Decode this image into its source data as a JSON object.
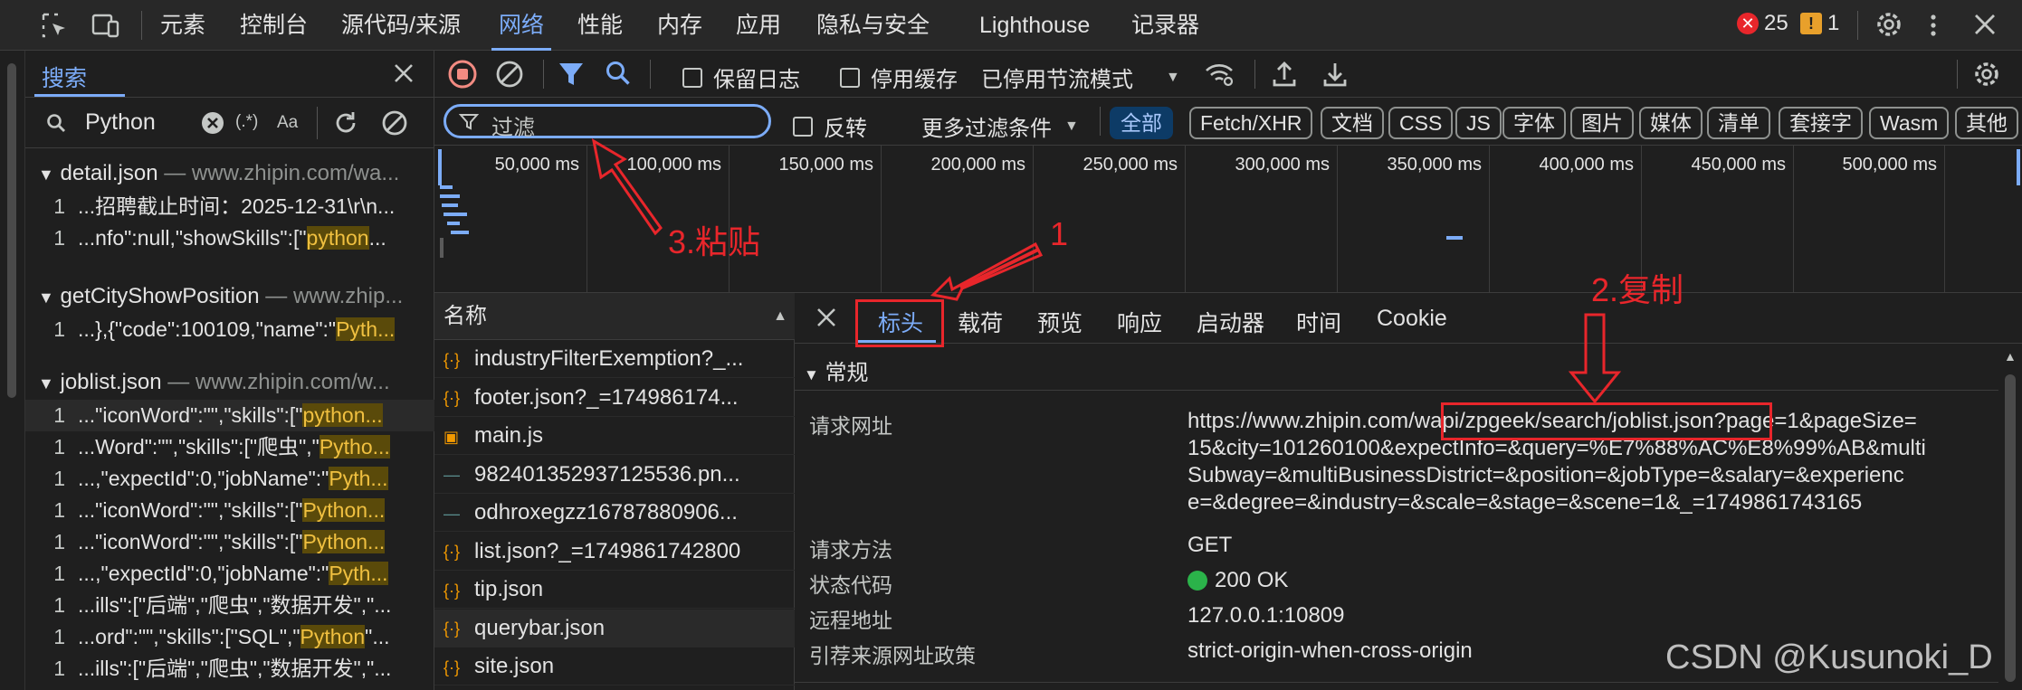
{
  "top_tabs": [
    "元素",
    "控制台",
    "源代码/来源",
    "网络",
    "性能",
    "内存",
    "应用",
    "隐私与安全",
    "Lighthouse",
    "记录器"
  ],
  "active_top_tab": "网络",
  "errors_count": "25",
  "warnings_count": "1",
  "search_panel": {
    "title": "搜索",
    "query": "Python",
    "regex_label": "(.*)",
    "case_label": "Aa",
    "results": [
      {
        "file": "detail.json",
        "url": "— www.zhipin.com/wa...",
        "lines": [
          {
            "num": "1",
            "pre": "...招聘截止时间：2025-12-31\\r\\n...",
            "hl": "",
            "post": ""
          },
          {
            "num": "1",
            "pre": "...nfo\":null,\"showSkills\":[\"",
            "hl": "python",
            "post": "..."
          }
        ]
      },
      {
        "file": "getCityShowPosition",
        "url": "— www.zhip...",
        "lines": [
          {
            "num": "1",
            "pre": "...},{\"code\":100109,\"name\":\"",
            "hl": "Pyth...",
            "post": ""
          }
        ]
      },
      {
        "file": "joblist.json",
        "url": "— www.zhipin.com/w...",
        "lines": [
          {
            "num": "1",
            "pre": "...\"iconWord\":\"\",\"skills\":[\"",
            "hl": "python...",
            "post": ""
          },
          {
            "num": "1",
            "pre": "...Word\":\"\",\"skills\":[\"爬虫\",\"",
            "hl": "Pytho...",
            "post": ""
          },
          {
            "num": "1",
            "pre": "...,\"expectId\":0,\"jobName\":\"",
            "hl": "Pyth...",
            "post": ""
          },
          {
            "num": "1",
            "pre": "...\"iconWord\":\"\",\"skills\":[\"",
            "hl": "Python...",
            "post": ""
          },
          {
            "num": "1",
            "pre": "...\"iconWord\":\"\",\"skills\":[\"",
            "hl": "Python...",
            "post": ""
          },
          {
            "num": "1",
            "pre": "...,\"expectId\":0,\"jobName\":\"",
            "hl": "Pyth...",
            "post": ""
          },
          {
            "num": "1",
            "pre": "...ills\":[\"后端\",\"爬虫\",\"数据开发\",\"...",
            "hl": "",
            "post": ""
          },
          {
            "num": "1",
            "pre": "...ord\":\"\",\"skills\":[\"SQL\",\"",
            "hl": "Python",
            "post": "\"..."
          },
          {
            "num": "1",
            "pre": "...ills\":[\"后端\",\"爬虫\",\"数据开发\",\"...",
            "hl": "",
            "post": ""
          }
        ]
      }
    ]
  },
  "toolbar": {
    "preserve_log": "保留日志",
    "disable_cache": "停用缓存",
    "throttling": "已停用节流模式"
  },
  "filter": {
    "placeholder": "过滤",
    "invert": "反转",
    "more_filters": "更多过滤条件",
    "types": [
      "全部",
      "Fetch/XHR",
      "文档",
      "CSS",
      "JS",
      "字体",
      "图片",
      "媒体",
      "清单",
      "套接字",
      "Wasm",
      "其他"
    ],
    "active_type": "全部"
  },
  "timeline_ticks": [
    "50,000 ms",
    "100,000 ms",
    "150,000 ms",
    "200,000 ms",
    "250,000 ms",
    "300,000 ms",
    "350,000 ms",
    "400,000 ms",
    "450,000 ms",
    "500,000 ms"
  ],
  "request_list": {
    "header": "名称",
    "items": [
      {
        "name": "industryFilterExemption?_...",
        "icon": "json-icon"
      },
      {
        "name": "footer.json?_=174986174...",
        "icon": "json-icon"
      },
      {
        "name": "main.js",
        "icon": "script-icon"
      },
      {
        "name": "982401352937125536.pn...",
        "icon": "image-icon"
      },
      {
        "name": "odhroxegzz16787880906...",
        "icon": "image-icon"
      },
      {
        "name": "list.json?_=1749861742800",
        "icon": "json-icon"
      },
      {
        "name": "tip.json",
        "icon": "json-icon"
      },
      {
        "name": "querybar.json",
        "icon": "json-icon"
      },
      {
        "name": "site.json",
        "icon": "json-icon"
      }
    ]
  },
  "details": {
    "tabs": [
      "标头",
      "载荷",
      "预览",
      "响应",
      "启动器",
      "时间",
      "Cookie"
    ],
    "active_tab": "标头",
    "section": "常规",
    "rows": {
      "request_url_label": "请求网址",
      "request_url_line1_a": "https://www.zhipin.com/",
      "request_url_line1_b": "wapi/zpgeek/search/joblist.json",
      "request_url_line1_c": "?page=1&pageSize=",
      "request_url_line2": "15&city=101260100&expectInfo=&query=%E7%88%AC%E8%99%AB&multi",
      "request_url_line3": "Subway=&multiBusinessDistrict=&position=&jobType=&salary=&experienc",
      "request_url_line4": "e=&degree=&industry=&scale=&stage=&scene=1&_=1749861743165",
      "method_label": "请求方法",
      "method": "GET",
      "status_label": "状态代码",
      "status": "200 OK",
      "remote_label": "远程地址",
      "remote": "127.0.0.1:10809",
      "referrer_label": "引荐来源网址政策",
      "referrer": "strict-origin-when-cross-origin"
    }
  },
  "annotations": {
    "step1": "1",
    "step2": "2.复制",
    "step3": "3.粘贴"
  },
  "watermark": "CSDN @Kusunoki_D",
  "colors": {
    "accent": "#7cacf8",
    "annotation_red": "#e8262b",
    "highlight": "#f0c040",
    "status_ok": "#2bb34a"
  }
}
